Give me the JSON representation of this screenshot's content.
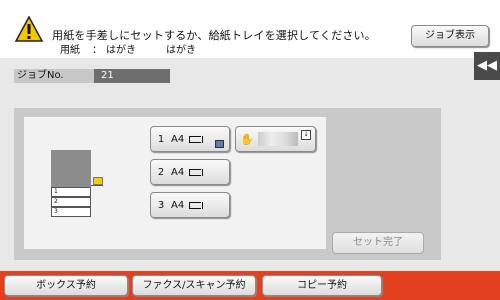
{
  "header": {
    "message_line1": "用紙を手差しにセットするか、給紙トレイを選択してください。",
    "paper_label": "用紙",
    "paper_sep": "：",
    "paper_value1": "はがき",
    "paper_value2": "はがき",
    "job_view_label": "ジョブ表示"
  },
  "job": {
    "label": "ジョブNo.",
    "number": "21"
  },
  "side_tab": {
    "icon": "double-chevron-left-icon",
    "glyph": "◀◀"
  },
  "machine": {
    "tray_labels": [
      "1",
      "2",
      "3"
    ]
  },
  "trays": [
    {
      "num": "1",
      "size": "A4"
    },
    {
      "num": "2",
      "size": "A4"
    },
    {
      "num": "3",
      "size": "A4"
    }
  ],
  "bypass": {
    "icon": "hand-icon"
  },
  "done_label": "セット完了",
  "footer": {
    "box_reserve": "ボックス予約",
    "fax_scan_reserve": "ファクス/スキャン予約",
    "copy_reserve": "コピー予約"
  },
  "colors": {
    "footer_bg": "#e2401e",
    "warning": "#f4c600"
  }
}
